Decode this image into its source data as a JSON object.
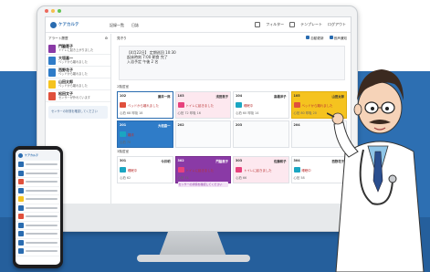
{
  "app": {
    "logo_text": "ケアカルテ",
    "tabs": [
      "記録一覧",
      "日誌"
    ],
    "header_links": [
      "フィルター",
      "テンプレート",
      "ログアウト"
    ]
  },
  "sidebar": {
    "header": "アラート履歴",
    "items": [
      {
        "name": "門脇恵子",
        "sub": "トイレに起き上がりました",
        "color": "#8a3aa6"
      },
      {
        "name": "大垣喜一",
        "sub": "ベッドから離れました",
        "color": "#2f7cc8"
      },
      {
        "name": "西野花子",
        "sub": "ベッドから離れました",
        "color": "#2f7cc8"
      },
      {
        "name": "山田太郎",
        "sub": "ベッドから離れました",
        "color": "#f5c31f"
      },
      {
        "name": "松田文子",
        "sub": "センサーが外れています",
        "color": "#e0503c"
      }
    ],
    "note": "センサーの状態を確認してください"
  },
  "main": {
    "top_left": "見守り",
    "checks": [
      "自動更新",
      "音声通知"
    ],
    "info_lines": [
      "【4月22日】 定期巡回 10:30",
      "起床時刻 7:00 朝食 完了",
      "入浴予定 午後 2 名"
    ],
    "section1": "2階居室",
    "section2": "3階居室",
    "row1": [
      {
        "room": "102",
        "name": "藤井一郎",
        "status": "ベッドから離れました",
        "vals": "心拍 68 呼吸 18",
        "style": "sel"
      },
      {
        "room": "103",
        "name": "浅田恵子",
        "status": "トイレに起きました",
        "vals": "心拍 72 呼吸 16",
        "style": "tint-pink"
      },
      {
        "room": "104",
        "name": "高橋洋子",
        "status": "睡眠中",
        "vals": "心拍 60 呼吸 14",
        "style": ""
      },
      {
        "room": "105",
        "name": "山田太郎",
        "status": "ベッドから離れました",
        "vals": "心拍 80 呼吸 20",
        "style": "yellow"
      }
    ],
    "row2": [
      {
        "room": "201",
        "name": "大垣喜一",
        "status": "離床",
        "vals": "心拍 70",
        "style": "blue"
      },
      {
        "room": "202",
        "name": "",
        "status": "",
        "vals": "",
        "style": "blank"
      },
      {
        "room": "203",
        "name": "",
        "status": "",
        "vals": "",
        "style": "blank"
      },
      {
        "room": "204",
        "name": "",
        "status": "",
        "vals": "",
        "style": "blank"
      }
    ],
    "row3": [
      {
        "room": "301",
        "name": "今井明",
        "status": "睡眠中",
        "vals": "心拍 62",
        "style": ""
      },
      {
        "room": "302",
        "name": "門脇恵子",
        "status": "トイレに起きました",
        "vals": "心拍 74",
        "style": "purple",
        "warn": "センサーの状態を確認してください"
      },
      {
        "room": "303",
        "name": "佐藤和子",
        "status": "トイレに起きました",
        "vals": "心拍 66",
        "style": "tint-pink"
      },
      {
        "room": "304",
        "name": "西野花子",
        "status": "睡眠中",
        "vals": "心拍 58",
        "style": ""
      }
    ]
  },
  "phone": {
    "title": "ケアカルテ",
    "row_colors": [
      "#2a6cb0",
      "#2a6cb0",
      "#e0503c",
      "#2a6cb0",
      "#f5c31f",
      "#2a6cb0",
      "#e0503c",
      "#2a6cb0",
      "#2a6cb0",
      "#2a6cb0",
      "#2a6cb0"
    ]
  }
}
